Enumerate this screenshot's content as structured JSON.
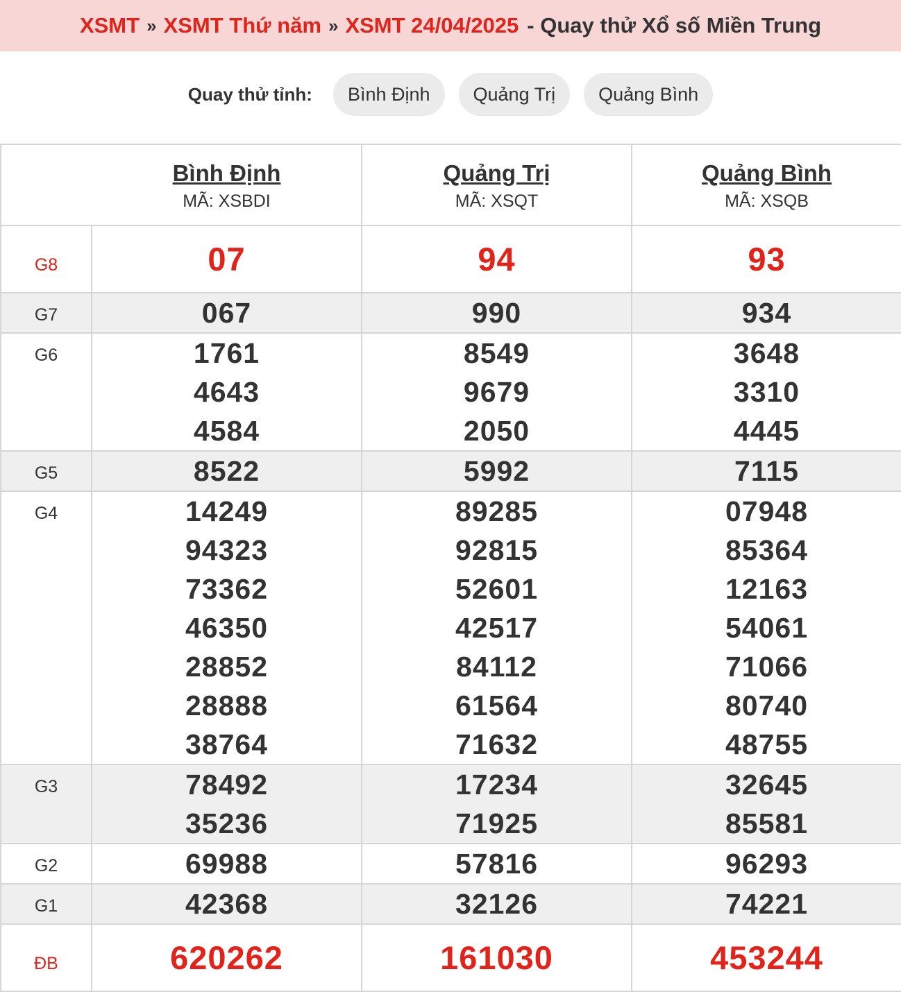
{
  "breadcrumb": {
    "items": [
      "XSMT",
      "XSMT Thứ năm",
      "XSMT 24/04/2025"
    ],
    "separator": "»",
    "suffix": "- Quay thử Xổ số Miền Trung"
  },
  "filter": {
    "label": "Quay thử tỉnh:",
    "chips": [
      "Bình Định",
      "Quảng Trị",
      "Quảng Bình"
    ]
  },
  "table": {
    "provinces": [
      {
        "name": "Bình Định",
        "code": "MÃ: XSBDI"
      },
      {
        "name": "Quảng Trị",
        "code": "MÃ: XSQT"
      },
      {
        "name": "Quảng Bình",
        "code": "MÃ: XSQB"
      }
    ],
    "prizes": [
      {
        "label": "G8",
        "values": [
          [
            "07"
          ],
          [
            "94"
          ],
          [
            "93"
          ]
        ]
      },
      {
        "label": "G7",
        "values": [
          [
            "067"
          ],
          [
            "990"
          ],
          [
            "934"
          ]
        ]
      },
      {
        "label": "G6",
        "values": [
          [
            "1761",
            "4643",
            "4584"
          ],
          [
            "8549",
            "9679",
            "2050"
          ],
          [
            "3648",
            "3310",
            "4445"
          ]
        ]
      },
      {
        "label": "G5",
        "values": [
          [
            "8522"
          ],
          [
            "5992"
          ],
          [
            "7115"
          ]
        ]
      },
      {
        "label": "G4",
        "values": [
          [
            "14249",
            "94323",
            "73362",
            "46350",
            "28852",
            "28888",
            "38764"
          ],
          [
            "89285",
            "92815",
            "52601",
            "42517",
            "84112",
            "61564",
            "71632"
          ],
          [
            "07948",
            "85364",
            "12163",
            "54061",
            "71066",
            "80740",
            "48755"
          ]
        ]
      },
      {
        "label": "G3",
        "values": [
          [
            "78492",
            "35236"
          ],
          [
            "17234",
            "71925"
          ],
          [
            "32645",
            "85581"
          ]
        ]
      },
      {
        "label": "G2",
        "values": [
          [
            "69988"
          ],
          [
            "57816"
          ],
          [
            "96293"
          ]
        ]
      },
      {
        "label": "G1",
        "values": [
          [
            "42368"
          ],
          [
            "32126"
          ],
          [
            "74221"
          ]
        ]
      },
      {
        "label": "ĐB",
        "values": [
          [
            "620262"
          ],
          [
            "161030"
          ],
          [
            "453244"
          ]
        ]
      }
    ]
  },
  "colors": {
    "accent_red": "#e0241b",
    "title_bg": "#f8d6d6",
    "chip_bg": "#ebebeb",
    "row_shade": "#efefef",
    "border": "#d6d6d6"
  }
}
